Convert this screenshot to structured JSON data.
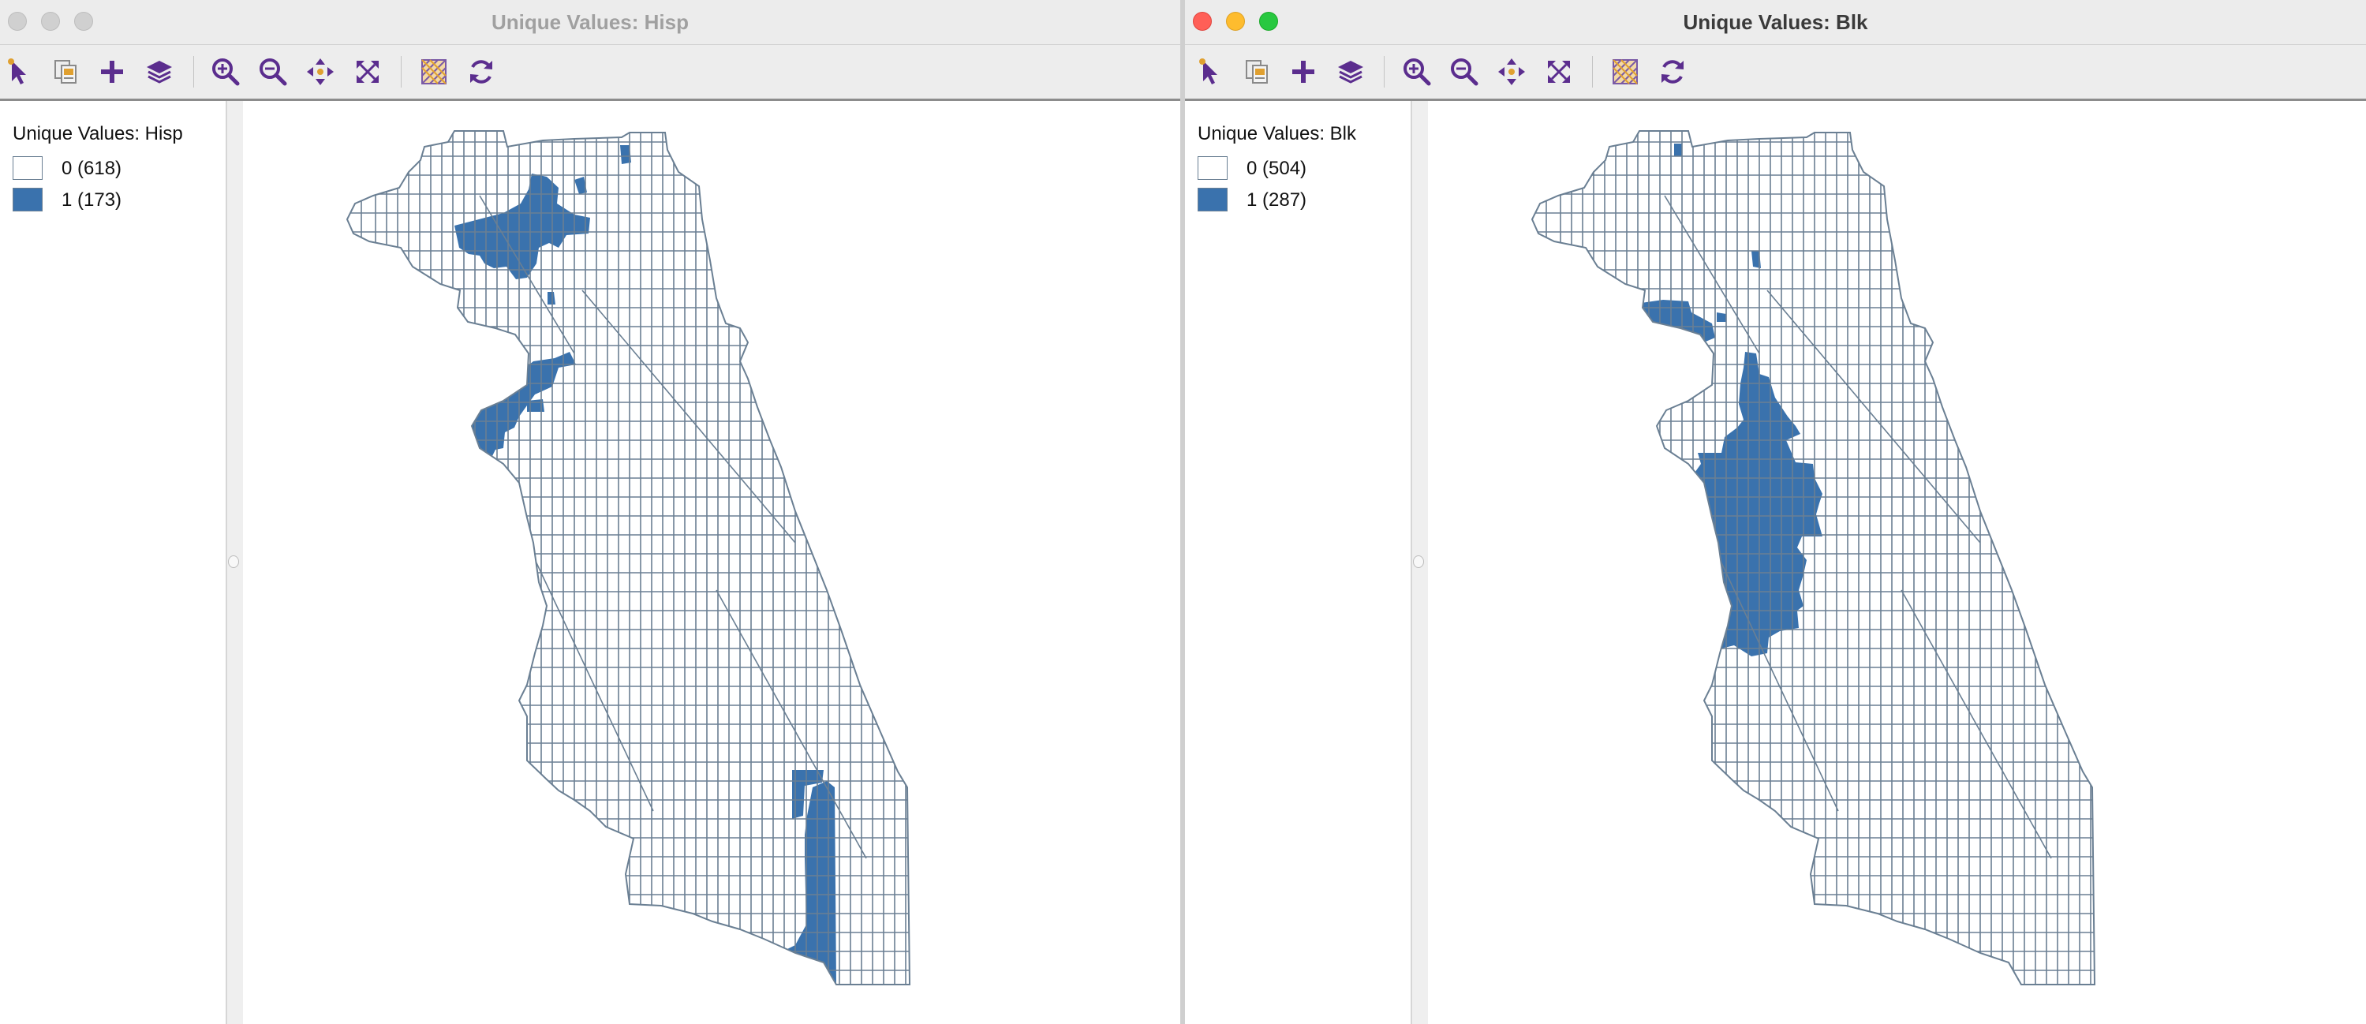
{
  "colors": {
    "selected_fill": "#3a72ad",
    "unselected_fill": "#ffffff",
    "tract_outline": "#6a7f93",
    "tool_purple": "#5b2d8e",
    "tool_orange": "#e0a030"
  },
  "toolbar_icons": [
    "select-arrow-icon",
    "copy-image-icon",
    "add-layer-icon",
    "layers-icon",
    "zoom-in-icon",
    "zoom-out-icon",
    "pan-icon",
    "full-extent-icon",
    "map-options-icon",
    "refresh-icon"
  ],
  "windows": [
    {
      "title": "Unique Values: Hisp",
      "active": false,
      "legend": {
        "title": "Unique Values: Hisp",
        "items": [
          {
            "label": "0 (618)",
            "value": 0,
            "count": 618
          },
          {
            "label": "1 (173)",
            "value": 1,
            "count": 173
          }
        ]
      }
    },
    {
      "title": "Unique Values: Blk",
      "active": true,
      "legend": {
        "title": "Unique Values: Blk",
        "items": [
          {
            "label": "0 (504)",
            "value": 0,
            "count": 504
          },
          {
            "label": "1 (287)",
            "value": 1,
            "count": 287
          }
        ]
      }
    }
  ]
}
